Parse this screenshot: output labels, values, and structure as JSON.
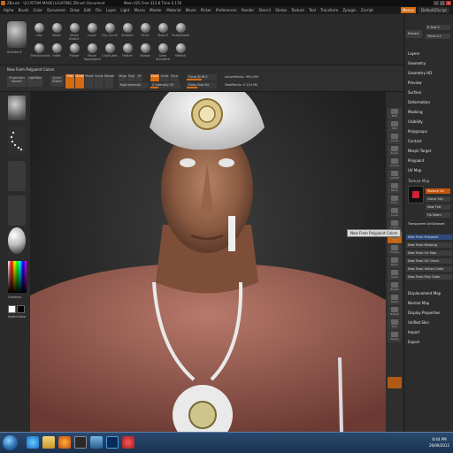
{
  "window": {
    "title": "ZBrush - \\[CUSTOM MASK] LIGHTING  ZBrush Document",
    "stats": "Mem 625  Free 312.8  Time 0.178"
  },
  "menubar": {
    "items": [
      "Alpha",
      "Brush",
      "Color",
      "Document",
      "Draw",
      "Edit",
      "File",
      "Layer",
      "Light",
      "Macro",
      "Marker",
      "Material",
      "Movie",
      "Picker",
      "Preferences",
      "Render",
      "Stencil",
      "Stroke",
      "Texture",
      "Tool",
      "Transform",
      "Zplugin",
      "Zscript"
    ],
    "menus_btn": "Menus",
    "script_label": "DefaultZScript"
  },
  "brushes": {
    "big_label": "Standard",
    "items": [
      "Clay",
      "Move",
      "Move Elastic",
      "Layer",
      "Clip Curve",
      "Smooth",
      "Pinch",
      "Slash3",
      "SnakeHook",
      "TrimDynamic",
      "Inflat",
      "Planar",
      "Move Topological",
      "ClayTubes",
      "Flatten",
      "Nudge",
      "Dam Standard",
      "hPolish"
    ]
  },
  "toolbar": {
    "title": "New From Polypaint Colors",
    "projection_master": "Projection Master",
    "lightbox": "LightBox",
    "quick_sketch": "Quick Sketch",
    "edit": "Edit",
    "draw": "Draw",
    "move": "Move",
    "scale": "Scale",
    "rotate": "Rotate",
    "mrgb": "Mrgb",
    "rgb": "Rgb",
    "m": "M",
    "zadd": "Zadd",
    "zsub": "Zsub",
    "zcut": "Zcut",
    "focal_shift": "Focal Shift 0",
    "z_intensity": "Z Intensity 25",
    "draw_size": "Draw Size 64",
    "rgb_intensity": "Rgb Intensity",
    "active_points": "ActivePoints: 993,000",
    "total_points": "TotalPoints: 9.224 Mil",
    "z_intensity_level": 0.25,
    "draw_size_level": 0.35,
    "focal_shift_level": 0.5
  },
  "left_shelf": {
    "gradient_label": "Gradient",
    "switch_color_label": "SwitchColor",
    "active_color": "#ffffff"
  },
  "right_shelf": [
    "BPR",
    "SPix",
    "Scroll",
    "Zoom",
    "Actual",
    "AAHalf",
    "Persp",
    "Floor",
    "Local",
    "L.Sym",
    "Xyz",
    "Frame",
    "Move",
    "Scale",
    "Rotate",
    "PolyF",
    "Transp",
    "Solo",
    "Xpose"
  ],
  "tray": {
    "extract_btn": "Extract",
    "e_smt": "E Smt 5",
    "thick": "Thick 0.1",
    "sections": [
      "Layers",
      "Geometry",
      "Geometry HD",
      "Preview",
      "Surface",
      "Deformation",
      "Masking",
      "Visibility",
      "Polygroups",
      "Contact",
      "Morph Target",
      "Polypaint",
      "UV Map",
      "Texture Map"
    ],
    "texture_btns": [
      "Texture On",
      "Clone Txtr",
      "New Txtr",
      "Fix Seam"
    ],
    "transparent_label": "Transparent  AntiAliased",
    "new_from": [
      "New From Polypaint",
      "New From Masking",
      "New From UV Map",
      "New From UV Check",
      "New From Vertex Order",
      "New From Poly Order"
    ],
    "lower_sections": [
      "Displacement Map",
      "Normal Map",
      "Display Properties",
      "Unified Skin",
      "Import",
      "Export"
    ]
  },
  "tooltip": "New From Polypaint Colors",
  "taskbar": {
    "time": "8:44 PM",
    "date": "26/09/2012",
    "apps": [
      "ie-icon",
      "explorer-icon",
      "firefox-icon",
      "zbrush-icon",
      "monitor-icon",
      "photoshop-icon",
      "media-icon"
    ]
  },
  "colors": {
    "accent": "#d46b13",
    "selection": "#2e4a7c"
  }
}
